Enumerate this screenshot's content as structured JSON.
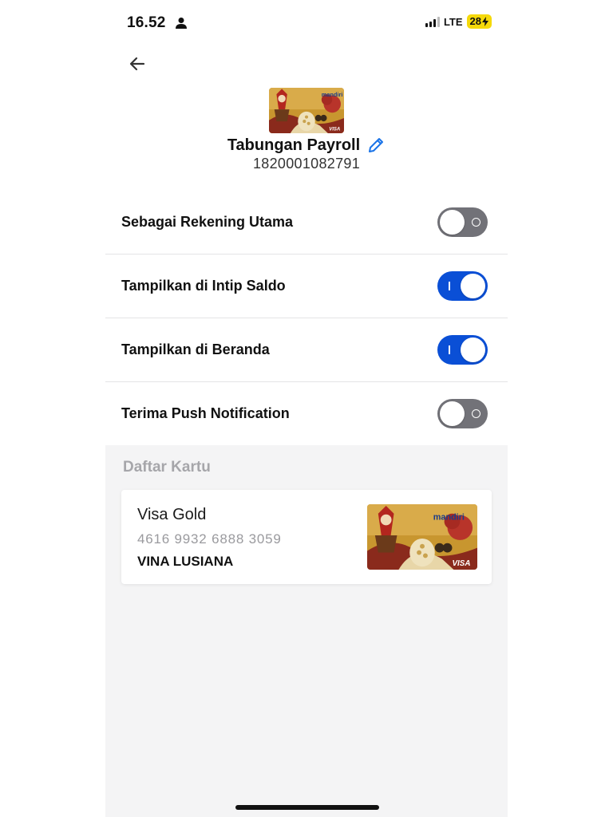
{
  "status_bar": {
    "time": "16.52",
    "network": "LTE",
    "battery": "28"
  },
  "account": {
    "title": "Tabungan Payroll",
    "number": "1820001082791",
    "card_brand": "mandiri",
    "card_network": "VISA"
  },
  "settings": [
    {
      "label": "Sebagai Rekening Utama",
      "enabled": false
    },
    {
      "label": "Tampilkan di Intip Saldo",
      "enabled": true
    },
    {
      "label": "Tampilkan di Beranda",
      "enabled": true
    },
    {
      "label": "Terima Push Notification",
      "enabled": false
    }
  ],
  "card_list": {
    "title": "Daftar Kartu",
    "cards": [
      {
        "type": "Visa Gold",
        "number": "4616 9932 6888 3059",
        "holder": "VINA LUSIANA",
        "brand": "mandiri",
        "network": "VISA"
      }
    ]
  },
  "icons": {
    "back": "arrow-left-icon",
    "edit": "pencil-icon",
    "person": "person-icon"
  },
  "colors": {
    "toggle_on": "#0a4fd6",
    "toggle_off": "#727278",
    "edit_icon": "#1a73e8",
    "battery": "#f5d90a"
  }
}
